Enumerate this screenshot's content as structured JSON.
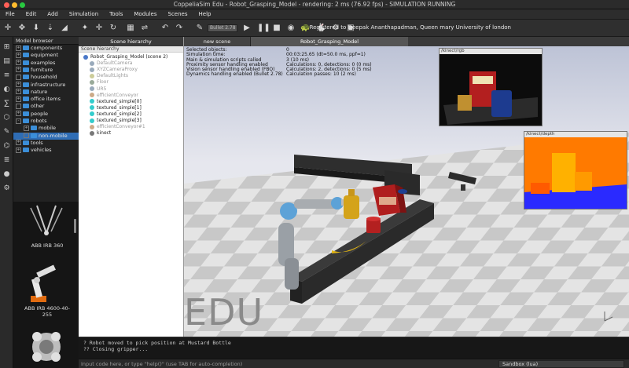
{
  "window": {
    "title": "CoppeliaSim Edu - Robot_Grasping_Model - rendering: 2 ms (76.92 fps) - SIMULATION RUNNING"
  },
  "menu": [
    "File",
    "Edit",
    "Add",
    "Simulation",
    "Tools",
    "Modules",
    "Scenes",
    "Help"
  ],
  "toolbar": {
    "engine_value": "Bullet 2.78",
    "registration": "Registered to Deepak Ananthapadman, Queen mary University of london"
  },
  "model_browser": {
    "title": "Model browser",
    "items": [
      {
        "label": "components",
        "expander": "+"
      },
      {
        "label": "equipment",
        "expander": "+"
      },
      {
        "label": "examples",
        "expander": "+"
      },
      {
        "label": "furniture",
        "expander": "+"
      },
      {
        "label": "household",
        "expander": ""
      },
      {
        "label": "infrastructure",
        "expander": "+"
      },
      {
        "label": "nature",
        "expander": "+"
      },
      {
        "label": "office items",
        "expander": "+"
      },
      {
        "label": "other",
        "expander": ""
      },
      {
        "label": "people",
        "expander": "+"
      },
      {
        "label": "robots",
        "expander": "-"
      },
      {
        "label": "mobile",
        "expander": "+"
      },
      {
        "label": "non-mobile",
        "expander": ""
      },
      {
        "label": "tools",
        "expander": "+"
      },
      {
        "label": "vehicles",
        "expander": "+"
      }
    ],
    "thumbnails": [
      "ABB IRB 360",
      "ABB IRB 4600-40-255"
    ]
  },
  "scene_hierarchy": {
    "tab": "Scene hierarchy",
    "header": "Scene hierarchy",
    "items": [
      {
        "label": "Robot_Grasping_Model (scene 2)",
        "dim": false,
        "color": "#4a78c8"
      },
      {
        "label": "DefaultCamera",
        "dim": true,
        "color": "#9ab"
      },
      {
        "label": "XYZCameraProxy",
        "dim": true,
        "color": "#9ab"
      },
      {
        "label": "DefaultLights",
        "dim": true,
        "color": "#cc9"
      },
      {
        "label": "Floor",
        "dim": true,
        "color": "#9a9"
      },
      {
        "label": "UR5",
        "dim": true,
        "color": "#9ab"
      },
      {
        "label": "efficientConveyor",
        "dim": true,
        "color": "#ca8"
      },
      {
        "label": "textured_simple[0]",
        "dim": false,
        "color": "#3cc"
      },
      {
        "label": "textured_simple[1]",
        "dim": false,
        "color": "#3cc"
      },
      {
        "label": "textured_simple[2]",
        "dim": false,
        "color": "#3cc"
      },
      {
        "label": "textured_simple[3]",
        "dim": false,
        "color": "#3cc"
      },
      {
        "label": "efficientConveyor#1",
        "dim": true,
        "color": "#ca8"
      },
      {
        "label": "kinect",
        "dim": false,
        "color": "#777"
      }
    ]
  },
  "viewtabs": {
    "left": "new scene",
    "right": "Robot_Grasping_Model"
  },
  "stats": {
    "labels": [
      "Selected objects:",
      "Simulation time:",
      "Main & simulation scripts called",
      "Proximity sensor handling enabled",
      "Vision sensor handling enabled (FBO)",
      "Dynamics handling enabled (Bullet 2.78)"
    ],
    "values": [
      "0",
      "00:03:25.65 (dt=50.0 ms, ppf=1)",
      "3 (10 ms)",
      "Calculations: 0, detections: 0 (0 ms)",
      "Calculations: 2, detections: 0 (5 ms)",
      "Calculation passes: 10 (2 ms)"
    ]
  },
  "floats": {
    "rgb": "/kinect/rgb",
    "depth": "/kinect/depth"
  },
  "edu": "EDU",
  "console": {
    "lines": [
      "? Robot moved to pick position at Mustard Bottle",
      "?? Closing gripper..."
    ]
  },
  "input": {
    "placeholder": "Input code here, or type \"help()\" (use TAB for auto-completion)",
    "sandbox": "Sandbox (lua)"
  }
}
